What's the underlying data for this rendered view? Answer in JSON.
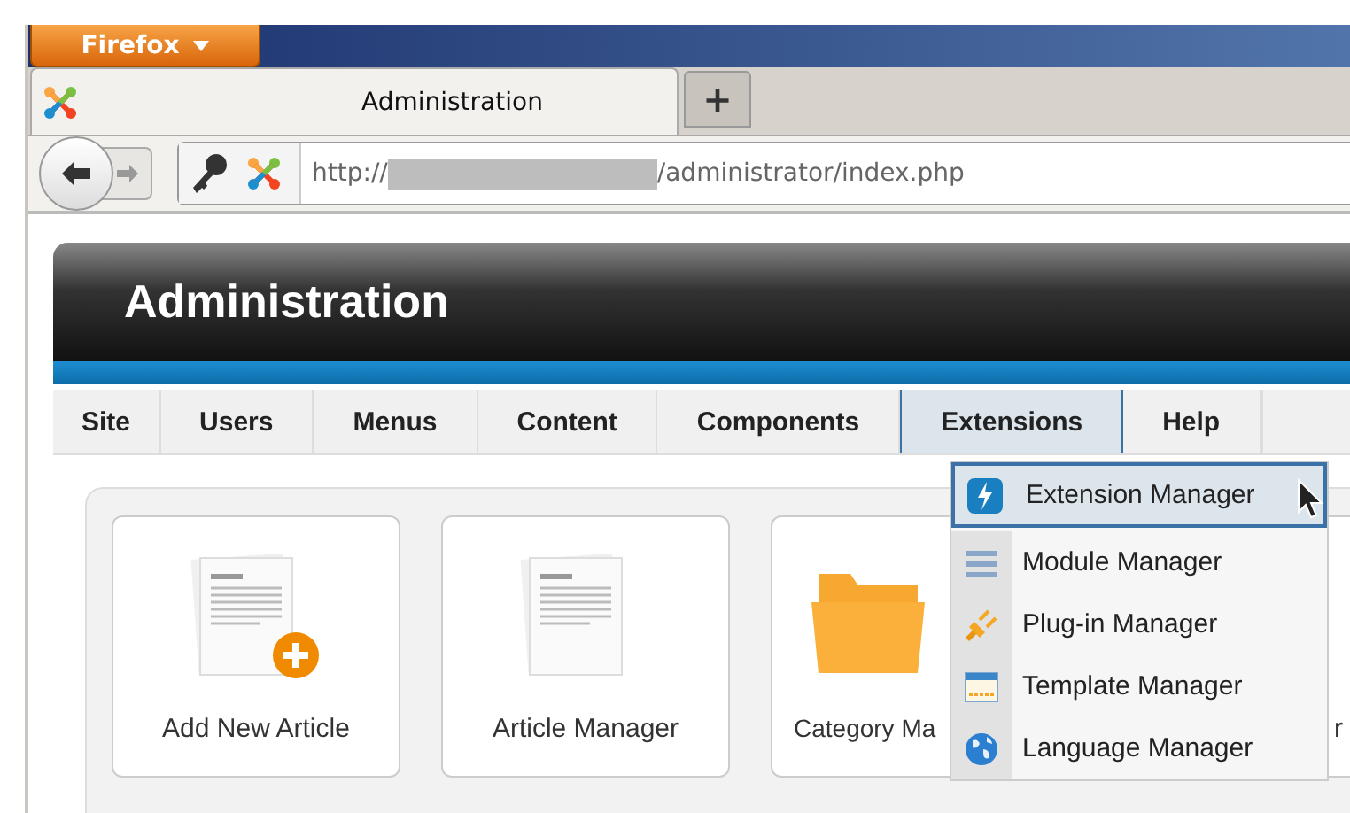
{
  "browser": {
    "menu_button": "Firefox",
    "tab": {
      "title": "Administration",
      "selected": true
    },
    "new_tab": "+",
    "url_prefix": "http://",
    "url_path": "/administrator/index.php"
  },
  "header": {
    "title": "Administration"
  },
  "menu": [
    {
      "label": "Site",
      "selected": false
    },
    {
      "label": "Users",
      "selected": false
    },
    {
      "label": "Menus",
      "selected": false
    },
    {
      "label": "Content",
      "selected": false
    },
    {
      "label": "Components",
      "selected": false
    },
    {
      "label": "Extensions",
      "selected": true
    },
    {
      "label": "Help",
      "selected": false
    }
  ],
  "dropdown": [
    {
      "label": "Extension Manager",
      "kind": "bolt",
      "selected": true
    },
    {
      "label": "Module Manager",
      "kind": "lines",
      "selected": false
    },
    {
      "label": "Plug-in Manager",
      "kind": "plug",
      "selected": false
    },
    {
      "label": "Template Manager",
      "kind": "window",
      "selected": false
    },
    {
      "label": "Language Manager",
      "kind": "globe",
      "selected": false
    }
  ],
  "cards": [
    {
      "label": "Add New Article",
      "kind": "article-add"
    },
    {
      "label": "Article Manager",
      "kind": "article"
    },
    {
      "label": "Category Ma",
      "kind": "folder"
    },
    {
      "label": "r",
      "kind": "hidden"
    }
  ]
}
